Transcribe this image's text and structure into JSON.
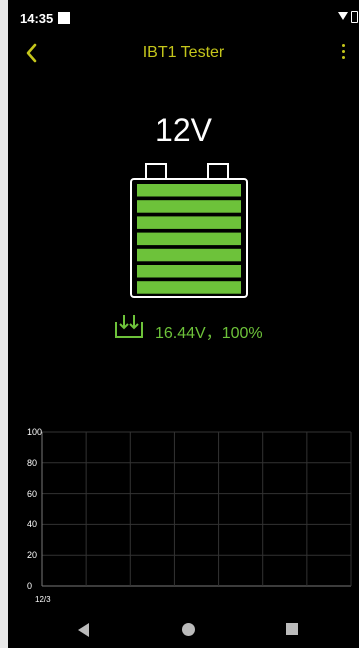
{
  "status_bar": {
    "time": "14:35"
  },
  "toolbar": {
    "title": "IBT1 Tester"
  },
  "battery": {
    "nominal_voltage": "12V",
    "reading": "16.44V，100%",
    "charge_percent": 100,
    "bar_color": "#6dc23a"
  },
  "colors": {
    "accent": "#c5c61b",
    "charge_green": "#6dc23a"
  },
  "chart_data": {
    "type": "line",
    "y_ticks": [
      "100",
      "80",
      "60",
      "40",
      "20",
      "0"
    ],
    "x_ticks": [
      "12/3"
    ],
    "ylim": [
      0,
      100
    ],
    "series": [],
    "grid": true
  },
  "nav": {
    "back_icon": "triangle-back-icon",
    "home_icon": "circle-home-icon",
    "recent_icon": "square-recent-icon"
  }
}
